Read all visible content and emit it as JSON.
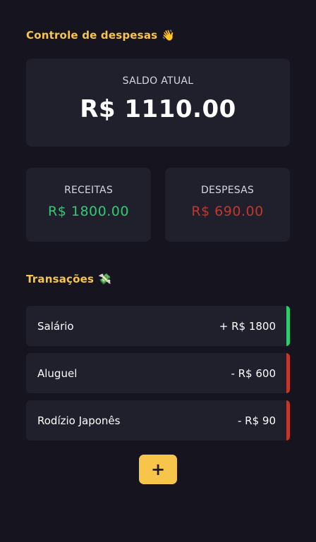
{
  "header": {
    "title": "Controle de despesas",
    "emoji": "👋"
  },
  "balance": {
    "label": "SALDO ATUAL",
    "value": "R$ 1110.00"
  },
  "income": {
    "label": "RECEITAS",
    "value": "R$ 1800.00",
    "color": "#2ecc71"
  },
  "expenses": {
    "label": "DESPESAS",
    "value": "R$ 690.00",
    "color": "#c0392b"
  },
  "transactions": {
    "title": "Transações",
    "emoji": "💸",
    "items": [
      {
        "name": "Salário",
        "amount": "+ R$ 1800",
        "type": "income"
      },
      {
        "name": "Aluguel",
        "amount": "- R$ 600",
        "type": "expense"
      },
      {
        "name": "Rodízio Japonês",
        "amount": "- R$ 90",
        "type": "expense"
      }
    ]
  },
  "add_button": {
    "label": "+"
  },
  "colors": {
    "accent": "#f6c54a",
    "income": "#2ecc71",
    "expense": "#c0392b",
    "background": "#16151f",
    "card": "#201f2c"
  }
}
